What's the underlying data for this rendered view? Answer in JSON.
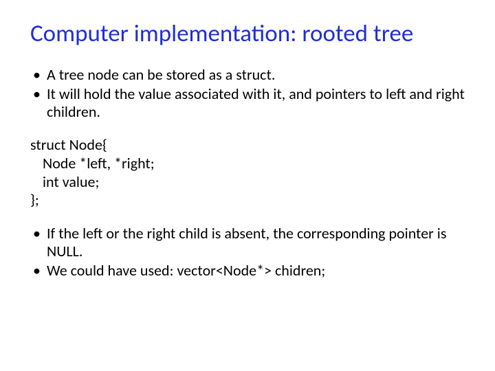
{
  "title": "Computer implementation: rooted tree",
  "bullets_top": [
    "A tree node can be stored as a struct.",
    "It will hold the value associated with it, and pointers to left and right children."
  ],
  "code": {
    "l1": "struct Node{",
    "l2": "Node *left, *right;",
    "l3": "int value;",
    "l4": "};"
  },
  "bullets_bottom": [
    "If the left or the right child is absent, the corresponding pointer is NULL.",
    "We could have used:  vector<Node*> chidren;"
  ]
}
